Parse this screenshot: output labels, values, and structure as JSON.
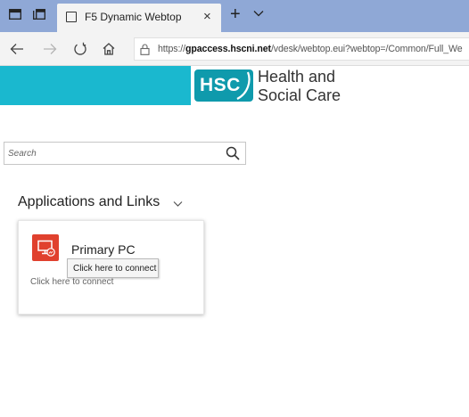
{
  "browser": {
    "tab": {
      "title": "F5 Dynamic Webtop",
      "close_glyph": "×"
    },
    "new_tab_glyph": "+",
    "tab_menu_glyph": "⌵",
    "address": {
      "url_prefix": "https://",
      "url_host": "gpaccess.hscni.net",
      "url_rest": "/vdesk/webtop.eui?webtop=/Common/Full_We"
    },
    "nav_icons": [
      "back-icon",
      "forward-icon",
      "refresh-icon",
      "home-icon",
      "lock-icon"
    ]
  },
  "header": {
    "logo_text": "HSC",
    "org_line1": "Health and",
    "org_line2": "Social Care",
    "colors": {
      "banner": "#1ab8cf",
      "logo_bg": "#0f9aac"
    }
  },
  "search": {
    "placeholder": "Search",
    "value": ""
  },
  "section": {
    "title": "Applications and Links"
  },
  "apps": [
    {
      "name": "Primary PC",
      "hint": "Click here to connect",
      "tooltip": "Click here to connect",
      "icon": "remote-desktop-icon",
      "icon_color": "#e0412e"
    }
  ]
}
